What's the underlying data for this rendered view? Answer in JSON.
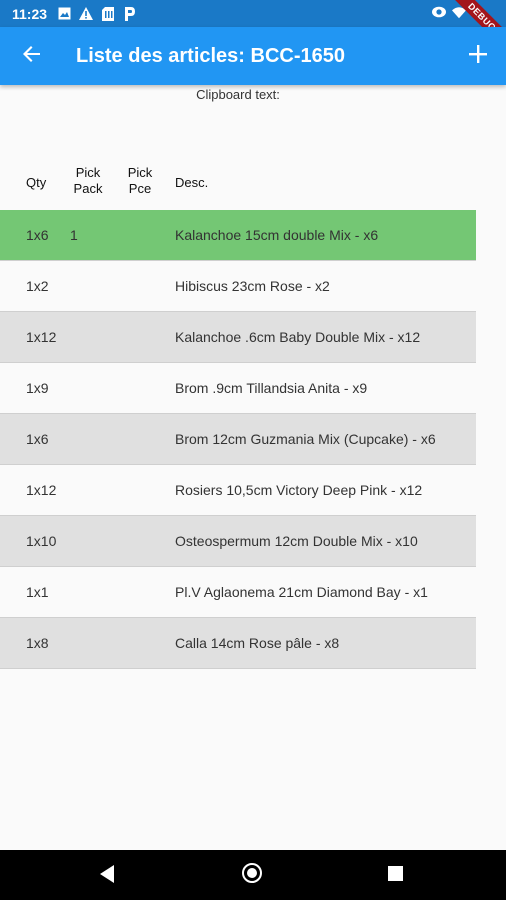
{
  "status_bar": {
    "time": "11:23",
    "left_icons": [
      "image-icon",
      "warning-icon",
      "sim-icon",
      "parking-icon"
    ],
    "right_icons": [
      "eye-icon",
      "wifi-icon",
      "battery-icon"
    ],
    "debug_label": "DEBUG"
  },
  "app_bar": {
    "title": "Liste des articles: BCC-1650",
    "back_icon": "arrow-back-icon",
    "add_icon": "plus-icon",
    "color": "#2196f3"
  },
  "clipboard": {
    "label": "Clipboard text:"
  },
  "table": {
    "headers": {
      "qty": "Qty",
      "pick_pack": "Pick Pack",
      "pick_pce": "Pick Pce",
      "desc": "Desc."
    },
    "rows": [
      {
        "qty": "1x6",
        "pick_pack": "1",
        "pick_pce": "",
        "desc": "Kalanchoe 15cm double Mix  - x6",
        "selected": true
      },
      {
        "qty": "1x2",
        "pick_pack": "",
        "pick_pce": "",
        "desc": "Hibiscus 23cm Rose  - x2",
        "selected": false
      },
      {
        "qty": "1x12",
        "pick_pack": "",
        "pick_pce": "",
        "desc": "Kalanchoe .6cm Baby Double Mix  - x12",
        "selected": false
      },
      {
        "qty": "1x9",
        "pick_pack": "",
        "pick_pce": "",
        "desc": "Brom .9cm Tillandsia Anita  - x9",
        "selected": false
      },
      {
        "qty": "1x6",
        "pick_pack": "",
        "pick_pce": "",
        "desc": "Brom 12cm Guzmania Mix (Cupcake)  - x6",
        "selected": false
      },
      {
        "qty": "1x12",
        "pick_pack": "",
        "pick_pce": "",
        "desc": "Rosiers 10,5cm Victory Deep Pink  - x12",
        "selected": false
      },
      {
        "qty": "1x10",
        "pick_pack": "",
        "pick_pce": "",
        "desc": "Osteospermum 12cm Double Mix  - x10",
        "selected": false
      },
      {
        "qty": "1x1",
        "pick_pack": "",
        "pick_pce": "",
        "desc": "Pl.V Aglaonema 21cm Diamond Bay  - x1",
        "selected": false
      },
      {
        "qty": "1x8",
        "pick_pack": "",
        "pick_pce": "",
        "desc": "Calla 14cm Rose pâle  - x8",
        "selected": false
      }
    ],
    "selected_color": "#74c774"
  },
  "nav_bar": {
    "icons": [
      "nav-back-icon",
      "nav-home-icon",
      "nav-recents-icon"
    ]
  }
}
